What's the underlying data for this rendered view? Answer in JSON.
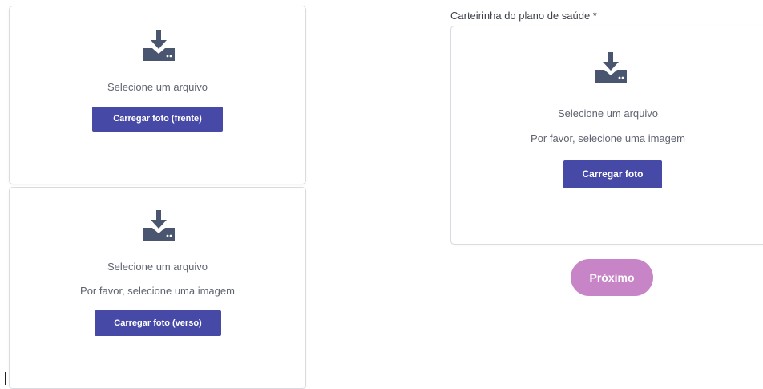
{
  "colors": {
    "primary_button": "#4749a6",
    "next_button": "#c784c6",
    "icon": "#4a5570",
    "border": "#d9dbe0"
  },
  "front_card": {
    "icon": "download-tray-icon",
    "select_text": "Selecione um arquivo",
    "button_label": "Carregar foto (frente)"
  },
  "back_card": {
    "icon": "download-tray-icon",
    "select_text": "Selecione um arquivo",
    "hint_text": "Por favor, selecione uma imagem",
    "button_label": "Carregar foto (verso)"
  },
  "health_plan": {
    "label": "Carteirinha do plano de saúde *",
    "icon": "download-tray-icon",
    "select_text": "Selecione um arquivo",
    "hint_text": "Por favor, selecione uma imagem",
    "button_label": "Carregar foto"
  },
  "next_button": {
    "label": "Próximo"
  }
}
